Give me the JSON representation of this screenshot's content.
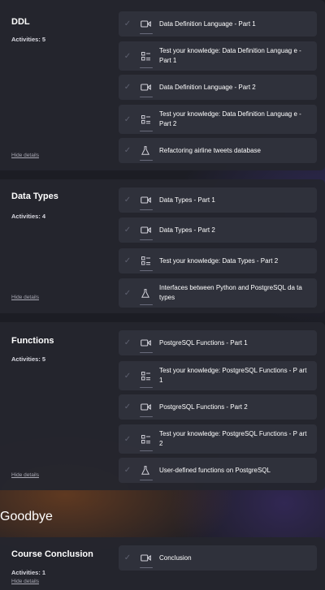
{
  "modules": [
    {
      "title": "DDL",
      "activities_label": "Activities: 5",
      "hide_label": "Hide details",
      "items": [
        {
          "label": "Data Definition Language - Part 1",
          "kind": "video-icon"
        },
        {
          "label": "Test your knowledge: Data Definition Languag e - Part 1",
          "kind": "quiz-icon"
        },
        {
          "label": "Data Definition Language - Part 2",
          "kind": "video-icon"
        },
        {
          "label": "Test your knowledge: Data Definition Languag e - Part 2",
          "kind": "quiz-icon"
        },
        {
          "label": "Refactoring airline tweets database",
          "kind": "flask-icon"
        }
      ]
    },
    {
      "title": "Data Types",
      "activities_label": "Activities: 4",
      "hide_label": "Hide details",
      "items": [
        {
          "label": "Data Types - Part 1",
          "kind": "video-icon"
        },
        {
          "label": "Data Types - Part 2",
          "kind": "video-icon"
        },
        {
          "label": "Test your knowledge: Data Types - Part 2",
          "kind": "quiz-icon"
        },
        {
          "label": "Interfaces between Python and PostgreSQL da ta types",
          "kind": "flask-icon"
        }
      ]
    },
    {
      "title": "Functions",
      "activities_label": "Activities: 5",
      "hide_label": "Hide details",
      "items": [
        {
          "label": "PostgreSQL Functions - Part 1",
          "kind": "video-icon"
        },
        {
          "label": "Test your knowledge: PostgreSQL Functions - P art 1",
          "kind": "quiz-icon"
        },
        {
          "label": "PostgreSQL Functions - Part 2",
          "kind": "video-icon"
        },
        {
          "label": "Test your knowledge: PostgreSQL Functions - P art 2",
          "kind": "quiz-icon"
        },
        {
          "label": "User-defined functions on PostgreSQL",
          "kind": "flask-icon"
        }
      ]
    }
  ],
  "section_heading": "Goodbye",
  "conclusion": {
    "title": "Course Conclusion",
    "activities_label": "Activities: 1",
    "hide_label": "Hide details",
    "items": [
      {
        "label": "Conclusion",
        "kind": "video-icon"
      }
    ]
  }
}
